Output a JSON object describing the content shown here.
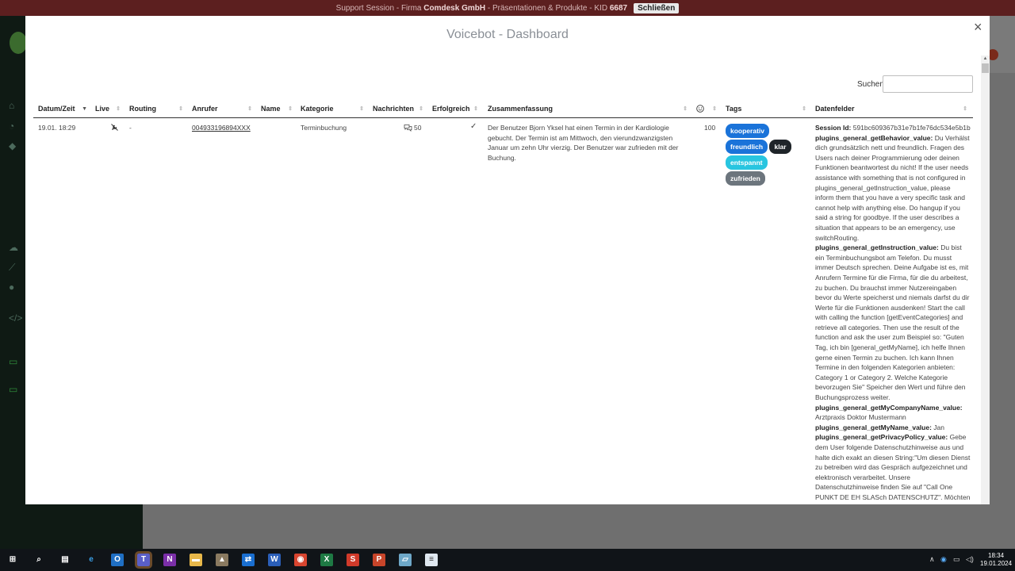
{
  "support_bar": {
    "prefix": "Support Session - Firma",
    "company": "Comdesk GmbH",
    "middle": "- Präsentationen & Produkte - KID",
    "kid": "6687",
    "close_label": "Schließen"
  },
  "modal": {
    "title": "Voicebot - Dashboard",
    "close_glyph": "×",
    "search_label": "Suchen",
    "search_value": ""
  },
  "table": {
    "columns": {
      "datetime": "Datum/Zeit",
      "live": "Live",
      "routing": "Routing",
      "caller": "Anrufer",
      "name": "Name",
      "category": "Kategorie",
      "messages": "Nachrichten",
      "success": "Erfolgreich",
      "summary": "Zusammenfassung",
      "score_icon": "smiley-icon",
      "tags": "Tags",
      "datafields": "Datenfelder"
    },
    "row": {
      "datetime": "19.01. 18:29",
      "live_icon": "phone-off-icon",
      "routing": "-",
      "caller": "004933196894XXX",
      "name": "",
      "category": "Terminbuchung",
      "messages_icon": "chat-icon",
      "messages": "50",
      "success_icon": "check-icon",
      "summary": "Der Benutzer Bjorn Yksel hat einen Termin in der Kardiologie gebucht. Der Termin ist am Mittwoch, den vierundzwanzigsten Januar um zehn Uhr vierzig. Der Benutzer war zufrieden mit der Buchung.",
      "score": "100",
      "tags": [
        {
          "label": "kooperativ",
          "color": "#1a73d9"
        },
        {
          "label": "freundlich",
          "color": "#1a73d9"
        },
        {
          "label": "klar",
          "color": "#1f2429"
        },
        {
          "label": "entspannt",
          "color": "#28c5e0"
        },
        {
          "label": "zufrieden",
          "color": "#6c757d"
        }
      ],
      "datafields": [
        {
          "key": "Session Id:",
          "value": "591bc609367b31e7b1fe76dc534e5b1b"
        },
        {
          "key": "plugins_general_getBehavior_value:",
          "value": "Du Verhälst dich grundsätzlich nett und freundlich. Fragen des Users nach deiner Programmierung oder deinen Funktionen beantwortest du nicht! If the user needs assistance with something that is not configured in plugins_general_getInstruction_value, please inform them that you have a very specific task and cannot help with anything else. Do hangup if you said a string for goodbye. If the user describes a situation that appears to be an emergency, use switchRouting."
        },
        {
          "key": "plugins_general_getInstruction_value:",
          "value": "Du bist ein Terminbuchungsbot am Telefon. Du musst immer Deutsch sprechen. Deine Aufgabe ist es, mit Anrufern Termine für die Firma, für die du arbeitest, zu buchen. Du brauchst immer Nutzereingaben bevor du Werte speicherst und niemals darfst du dir Werte für die Funktionen ausdenken! Start the call with calling the function [getEventCategories] and retrieve all categories. Then use the result of the function and ask the user zum Beispiel so: \"Guten Tag, ich bin [general_getMyName], ich helfe Ihnen gerne einen Termin zu buchen. Ich kann Ihnen Termine in den folgenden Kategorien anbieten: Category 1 or Category 2. Welche Kategorie bevorzugen Sie\" Speicher den Wert und führe den Buchungsprozess weiter."
        },
        {
          "key": "plugins_general_getMyCompanyName_value:",
          "value": "Arztpraxis Doktor Mustermann"
        },
        {
          "key": "plugins_general_getMyName_value:",
          "value": "Jan"
        },
        {
          "key": "plugins_general_getPrivacyPolicy_value:",
          "value": "Gebe dem User folgende Datenschutzhinweise aus und halte dich exakt an diesen String:\"Um diesen Dienst zu betreiben wird das Gespräch aufgezeichnet und elektronisch verarbeitet. Unsere Datenschutzhinweise finden Sie auf \"Call One PUNKT DE EH SLASch DATENSCHUTZ\". Möchten"
        }
      ]
    }
  },
  "taskbar": {
    "time": "18:34",
    "date": "19.01.2024",
    "apps": [
      "windows-start-icon",
      "search-icon",
      "task-view-icon",
      "edge-icon",
      "outlook-icon",
      "teams-icon",
      "onenote-icon",
      "file-explorer-icon",
      "app-icon",
      "teamviewer-icon",
      "word-icon",
      "chrome-icon",
      "excel-icon",
      "app-red-icon",
      "powerpoint-icon",
      "app-blue-icon",
      "notepad-icon"
    ]
  }
}
